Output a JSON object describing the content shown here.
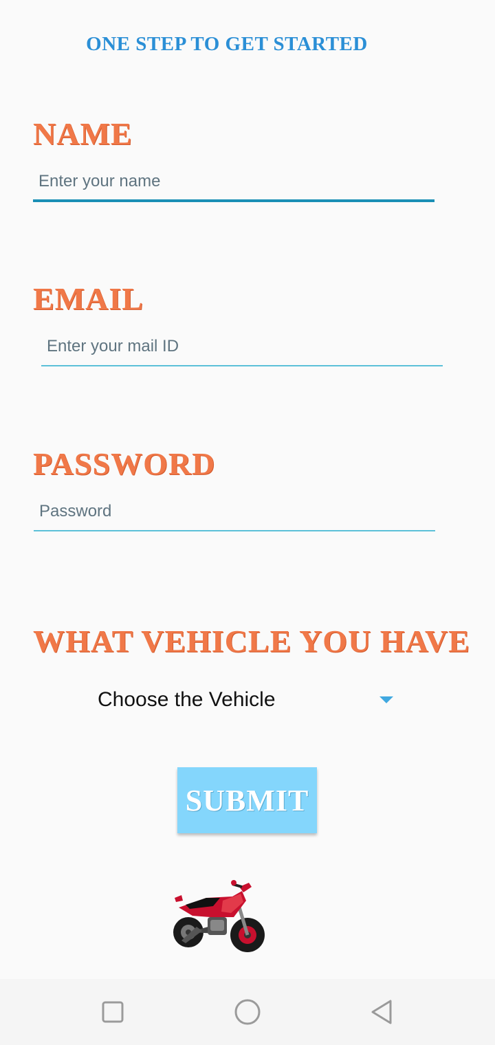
{
  "header": {
    "title": "One Step to get started"
  },
  "name": {
    "label": "Name",
    "placeholder": "Enter your name"
  },
  "email": {
    "label": "Email",
    "placeholder": "Enter your mail ID"
  },
  "password": {
    "label": "Password",
    "placeholder": "Password"
  },
  "vehicle": {
    "label": "What vehicle you have",
    "selected": "Choose the Vehicle"
  },
  "submit": {
    "label": "SUBMIT"
  },
  "colors": {
    "header": "#2b8fd6",
    "label": "#f07848",
    "focused_underline": "#1a8fb5",
    "underline": "#5bc0d8",
    "submit_bg": "#84d6fc"
  },
  "icons": {
    "bike": "motorcycle-icon",
    "nav_recent": "square-icon",
    "nav_home": "circle-icon",
    "nav_back": "triangle-back-icon",
    "dropdown": "caret-down-icon"
  }
}
